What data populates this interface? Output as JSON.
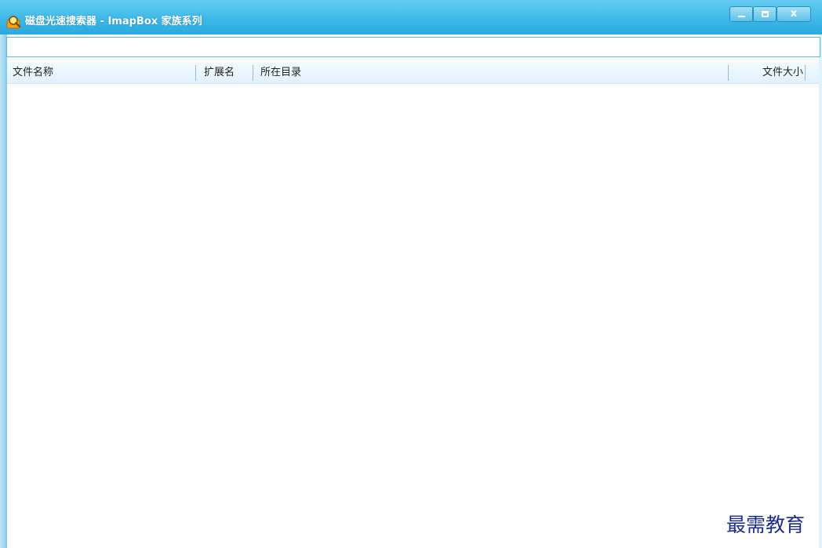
{
  "window": {
    "title": "磁盘光速搜索器 - ImapBox 家族系列",
    "icon": "magnifier-icon",
    "controls": {
      "minimize_icon": "minimize-icon",
      "maximize_icon": "maximize-icon",
      "close_label": "x"
    }
  },
  "search": {
    "value": "",
    "placeholder": ""
  },
  "file_list": {
    "columns": [
      {
        "label": "文件名称"
      },
      {
        "label": "扩展名"
      },
      {
        "label": "所在目录"
      },
      {
        "label": "文件大小"
      }
    ],
    "rows": []
  },
  "watermark": "最需教育",
  "colors": {
    "titlebar": "#3db8e8",
    "header_bg": "#e0f1fb",
    "input_border": "#5ab7e0",
    "watermark": "#1c2c8c"
  }
}
